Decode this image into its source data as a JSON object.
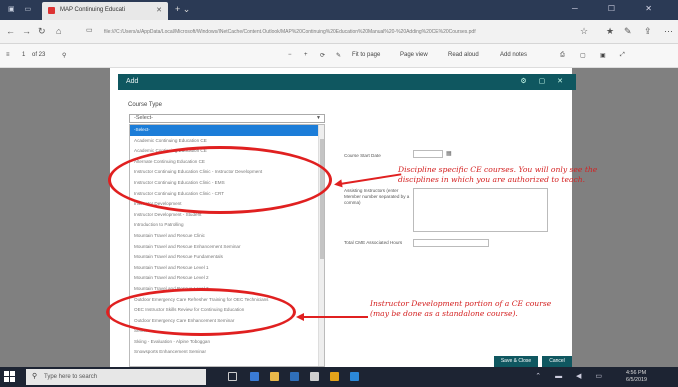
{
  "browser": {
    "tab_title": "MAP Continuing Educati",
    "url": "file:///C:/Users/a/AppData/Local/Microsoft/Windows/INetCache/Content.Outlook/MAP%20Continuing%20Education%20Manual%20-%20Adding%20CE%20Courses.pdf",
    "zoom": "of 23"
  },
  "pdf_toolbar": {
    "page": "1",
    "page_count": "of 23",
    "fit": "Fit to page",
    "page_view": "Page view",
    "read_aloud": "Read aloud",
    "add_notes": "Add notes"
  },
  "dialog": {
    "title": "Add",
    "course_type_label": "Course Type",
    "selected_value": "-Select-",
    "options": [
      "-Select-",
      "Academic Continuing Education CE",
      "Academic Continuing Education CE",
      "Alternate Continuing Education CE",
      "Instructor Continuing Education Clinic - Instructor Development",
      "Instructor Continuing Education Clinic - EMS",
      "Instructor Continuing Education Clinic - CRT",
      "Instructor Development",
      "Instructor Development - Student",
      "Introduction to Patrolling",
      "Mountain Travel and Rescue Clinic",
      "Mountain Travel and Rescue Enhancement Seminar",
      "Mountain Travel and Rescue Fundamentals",
      "Mountain Travel and Rescue Level 1",
      "Mountain Travel and Rescue Level 2",
      "Mountain Travel and Rescue Level 3",
      "Outdoor Emergency Care Refresher Training for OEC Technicians",
      "OEC Instructor Skills Review for Continuing Education",
      "Outdoor Emergency Care Enhancement Seminar",
      "Senior",
      "Skiing - Evaluation - Alpine Toboggan",
      "Snowsports Enhancement Seminar"
    ],
    "start_date_label": "Course Start Date",
    "instructor_label": "Assisting Instructors (enter Member number separated by a comma)",
    "total_hours_label": "Total CME Associated Hours",
    "save_close": "Save & Close",
    "cancel": "Cancel"
  },
  "annotations": {
    "discipline_note": "Discipline specific CE courses. You will only see the disciplines in which you are authorized to teach.",
    "instructor_note": "Instructor Development portion of a CE course (may be done as a standalone course)."
  },
  "taskbar": {
    "search_placeholder": "Type here to search",
    "time": "4:56 PM",
    "date": "6/5/2019"
  },
  "colors": {
    "dialog_header": "#0f5760",
    "selection": "#1c7dd8",
    "annotation": "#e02020",
    "taskbar": "#1d2433"
  }
}
